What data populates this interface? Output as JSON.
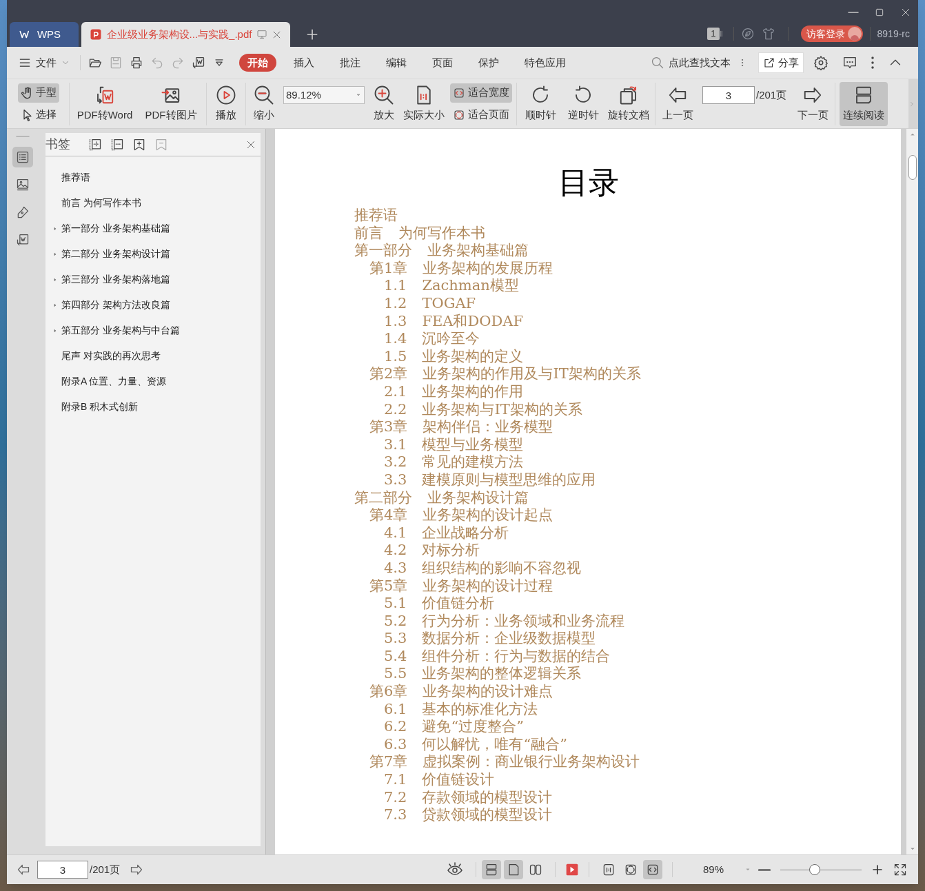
{
  "tabs": [
    {
      "label": "WPS",
      "kind": "home",
      "selected": false
    },
    {
      "label": "企业级业务架构设...与实践_.pdf",
      "kind": "document",
      "selected": true
    }
  ],
  "title_bar": {
    "window_count": "1",
    "login_button": "访客登录",
    "user_id": "8919-rc"
  },
  "menu": {
    "file": "文件",
    "tabs": [
      {
        "label": "开始",
        "selected": true
      },
      {
        "label": "插入",
        "selected": false
      },
      {
        "label": "批注",
        "selected": false
      },
      {
        "label": "编辑",
        "selected": false
      },
      {
        "label": "页面",
        "selected": false
      },
      {
        "label": "保护",
        "selected": false
      },
      {
        "label": "特色应用",
        "selected": false
      }
    ],
    "search_placeholder": "点此查找文本",
    "share": "分享"
  },
  "toolbar": {
    "modes": [
      {
        "label": "手型",
        "selected": true
      },
      {
        "label": "选择",
        "selected": false
      }
    ],
    "pdf_to_word": "PDF转Word",
    "pdf_to_image": "PDF转图片",
    "play": "播放",
    "zoom_out": "缩小",
    "zoom_value": "89.12%",
    "zoom_in": "放大",
    "actual_size": "实际大小",
    "fit": [
      {
        "label": "适合宽度",
        "selected": true
      },
      {
        "label": "适合页面",
        "selected": false
      }
    ],
    "rotate_cw": "顺时针",
    "rotate_ccw": "逆时针",
    "rotate_doc": "旋转文档",
    "prev_page": "上一页",
    "page": "3",
    "page_total": "/201页",
    "next_page": "下一页",
    "continuous": {
      "label": "连续阅读",
      "selected": true
    }
  },
  "side_rail": [
    {
      "kind": "outline",
      "selected": true
    },
    {
      "kind": "image",
      "selected": false
    },
    {
      "kind": "pen",
      "selected": false
    },
    {
      "kind": "convert",
      "selected": false
    }
  ],
  "bookmarks": {
    "title": "书签",
    "items": [
      {
        "label": "推荐语",
        "expandable": false
      },
      {
        "label": "前言 为何写作本书",
        "expandable": false
      },
      {
        "label": "第一部分 业务架构基础篇",
        "expandable": true
      },
      {
        "label": "第二部分 业务架构设计篇",
        "expandable": true
      },
      {
        "label": "第三部分 业务架构落地篇",
        "expandable": true
      },
      {
        "label": "第四部分 架构方法改良篇",
        "expandable": true
      },
      {
        "label": "第五部分 业务架构与中台篇",
        "expandable": true
      },
      {
        "label": "尾声 对实践的再次思考",
        "expandable": false
      },
      {
        "label": "附录A 位置、力量、资源",
        "expandable": false
      },
      {
        "label": "附录B 积木式创新",
        "expandable": false
      }
    ]
  },
  "document": {
    "title": "目录",
    "toc": [
      {
        "title": "推荐语"
      },
      {
        "number": "前言",
        "title": "为何写作本书"
      },
      {
        "number": "第一部分",
        "title": "业务架构基础篇",
        "children": [
          {
            "number": "第1章",
            "title": "业务架构的发展历程",
            "children": [
              {
                "number": "1.1",
                "title": "Zachman模型"
              },
              {
                "number": "1.2",
                "title": "TOGAF"
              },
              {
                "number": "1.3",
                "title": "FEA和DODAF"
              },
              {
                "number": "1.4",
                "title": "沉吟至今"
              },
              {
                "number": "1.5",
                "title": "业务架构的定义"
              }
            ]
          },
          {
            "number": "第2章",
            "title": "业务架构的作用及与IT架构的关系",
            "children": [
              {
                "number": "2.1",
                "title": "业务架构的作用"
              },
              {
                "number": "2.2",
                "title": "业务架构与IT架构的关系"
              }
            ]
          },
          {
            "number": "第3章",
            "title": "架构伴侣：业务模型",
            "children": [
              {
                "number": "3.1",
                "title": "模型与业务模型"
              },
              {
                "number": "3.2",
                "title": "常见的建模方法"
              },
              {
                "number": "3.3",
                "title": "建模原则与模型思维的应用"
              }
            ]
          }
        ]
      },
      {
        "number": "第二部分",
        "title": "业务架构设计篇",
        "children": [
          {
            "number": "第4章",
            "title": "业务架构的设计起点",
            "children": [
              {
                "number": "4.1",
                "title": "企业战略分析"
              },
              {
                "number": "4.2",
                "title": "对标分析"
              },
              {
                "number": "4.3",
                "title": "组织结构的影响不容忽视"
              }
            ]
          },
          {
            "number": "第5章",
            "title": "业务架构的设计过程",
            "children": [
              {
                "number": "5.1",
                "title": "价值链分析"
              },
              {
                "number": "5.2",
                "title": "行为分析：业务领域和业务流程"
              },
              {
                "number": "5.3",
                "title": "数据分析：企业级数据模型"
              },
              {
                "number": "5.4",
                "title": "组件分析：行为与数据的结合"
              },
              {
                "number": "5.5",
                "title": "业务架构的整体逻辑关系"
              }
            ]
          },
          {
            "number": "第6章",
            "title": "业务架构的设计难点",
            "children": [
              {
                "number": "6.1",
                "title": "基本的标准化方法"
              },
              {
                "number": "6.2",
                "title": "避免“过度整合”"
              },
              {
                "number": "6.3",
                "title": "何以解忧，唯有“融合”"
              }
            ]
          },
          {
            "number": "第7章",
            "title": "虚拟案例：商业银行业务架构设计",
            "children": [
              {
                "number": "7.1",
                "title": "价值链设计"
              },
              {
                "number": "7.2",
                "title": "存款领域的模型设计"
              },
              {
                "number": "7.3",
                "title": "贷款领域的模型设计"
              }
            ]
          }
        ]
      }
    ]
  },
  "status_bar": {
    "page": "3",
    "page_total": "/201页",
    "views": [
      {
        "kind": "continuous",
        "selected": true
      },
      {
        "kind": "single",
        "selected": true
      },
      {
        "kind": "double",
        "selected": false
      }
    ],
    "fits": [
      {
        "kind": "actual",
        "selected": false
      },
      {
        "kind": "page",
        "selected": false
      },
      {
        "kind": "width",
        "selected": true
      }
    ],
    "zoom": "89%",
    "zoom_slider": {
      "level": 0.42
    }
  }
}
